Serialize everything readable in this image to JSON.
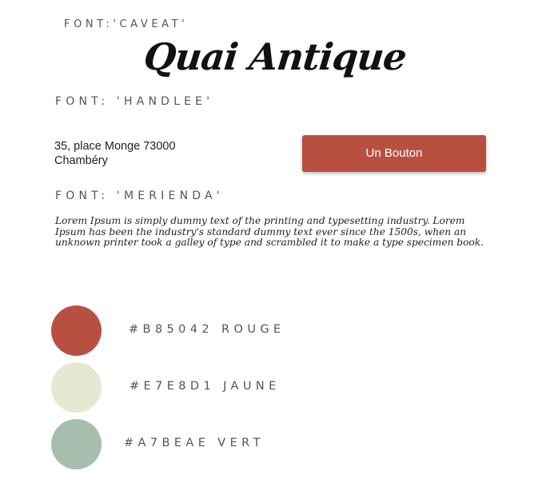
{
  "labels": {
    "caveat": "FONT:'CAVEAT'",
    "handlee": "FONT: 'HANDLEE'",
    "merienda": "FONT: 'MERIENDA'"
  },
  "logo": {
    "text": "Quai Antique"
  },
  "address": {
    "line1": "35, place Monge 73000",
    "line2": "Chambéry"
  },
  "button": {
    "label": "Un Bouton",
    "color": "#B85042"
  },
  "lorem": {
    "line1": "Lorem Ipsum is simply dummy text of the printing and typesetting industry. Lorem",
    "line2": "Ipsum has been the industry's standard dummy text ever since the 1500s, when an",
    "line3": "unknown printer took a galley of type and scrambled it to make a type specimen book."
  },
  "palette": [
    {
      "label": "#B85042 ROUGE",
      "color": "#B85042"
    },
    {
      "label": "#E7E8D1  JAUNE",
      "color": "#E7E8D1"
    },
    {
      "label": "#A7BEAE VERT",
      "color": "#A7BEAE"
    }
  ]
}
